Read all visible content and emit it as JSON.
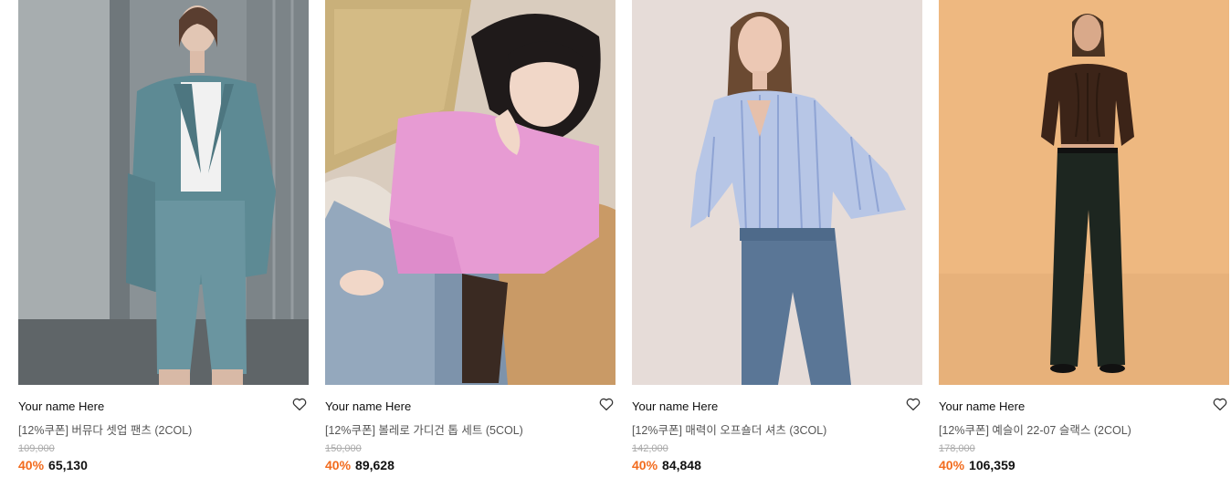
{
  "products": [
    {
      "brand": "Your name Here",
      "title": "[12%쿠폰] 버뮤다 셋업 팬츠 (2COL)",
      "original_price": "109,000",
      "discount": "40%",
      "price": "65,130",
      "image_desc": "photo of model wearing teal blazer and bermuda shorts",
      "heart_icon": "heart-outline-icon"
    },
    {
      "brand": "Your name Here",
      "title": "[12%쿠폰] 볼레로 가디건 톱 세트 (5COL)",
      "original_price": "150,000",
      "discount": "40%",
      "price": "89,628",
      "image_desc": "photo of model in pink cardigan and jeans",
      "heart_icon": "heart-outline-icon"
    },
    {
      "brand": "Your name Here",
      "title": "[12%쿠폰] 매력이 오프숄더 셔츠 (3COL)",
      "original_price": "142,000",
      "discount": "40%",
      "price": "84,848",
      "image_desc": "photo of model in blue striped shirt and jeans",
      "heart_icon": "heart-outline-icon"
    },
    {
      "brand": "Your name Here",
      "title": "[12%쿠폰] 예슬이 22-07 슬랙스 (2COL)",
      "original_price": "178,000",
      "discount": "40%",
      "price": "106,359",
      "image_desc": "photo of model in brown knit and dark wide slacks",
      "heart_icon": "heart-outline-icon"
    }
  ],
  "colors": {
    "discount": "#f26b1d",
    "brand_text": "#111111",
    "title_text": "#555555",
    "strike_text": "#aaaaaa"
  }
}
